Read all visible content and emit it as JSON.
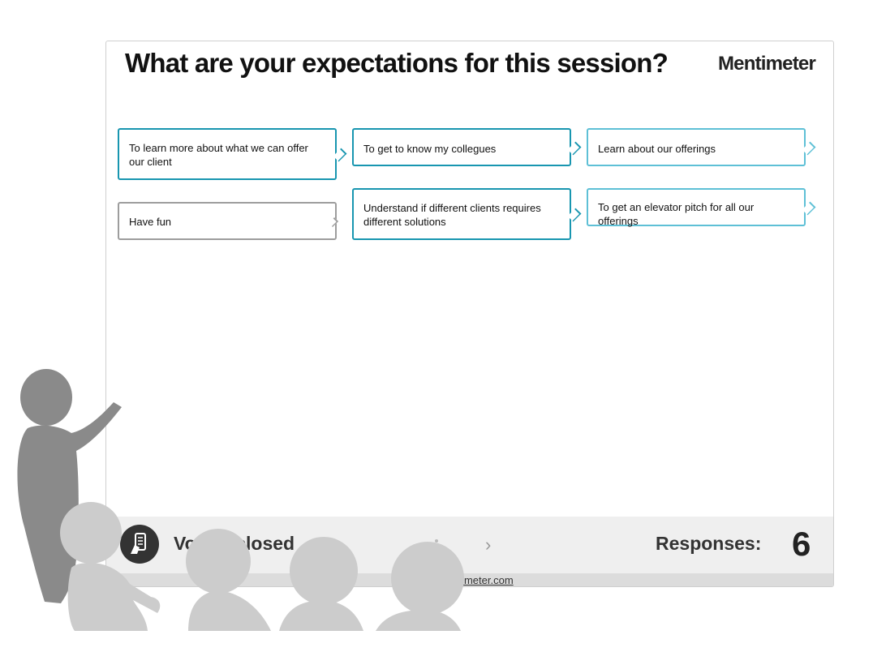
{
  "slide": {
    "question": "What are your expectations for this session?",
    "brand": "Mentimeter"
  },
  "responses": [
    {
      "text": "To learn more about what we can offer our client"
    },
    {
      "text": "To get to know my collegues"
    },
    {
      "text": "Learn about our offerings"
    },
    {
      "text": "Have fun"
    },
    {
      "text": "Understand if different clients requires different solutions"
    },
    {
      "text": "To get an elevator pitch for all our offerings"
    }
  ],
  "footer": {
    "vote_status": "Voting closed",
    "responses_label": "Responses:",
    "responses_count": "6",
    "url": "www.menti.com | mentimeter.com",
    "url_visible": "entimeter.com"
  },
  "colors": {
    "teal": "#1896b0",
    "light_teal": "#5ec0d6",
    "grey_border": "#9d9d9d",
    "footer_bg": "#efefef",
    "audience_presenter": "#8a8a8a",
    "audience_people": "#cccccc"
  },
  "icons": {
    "phone": "phone-vote-icon",
    "next": "chevron-right-icon"
  }
}
